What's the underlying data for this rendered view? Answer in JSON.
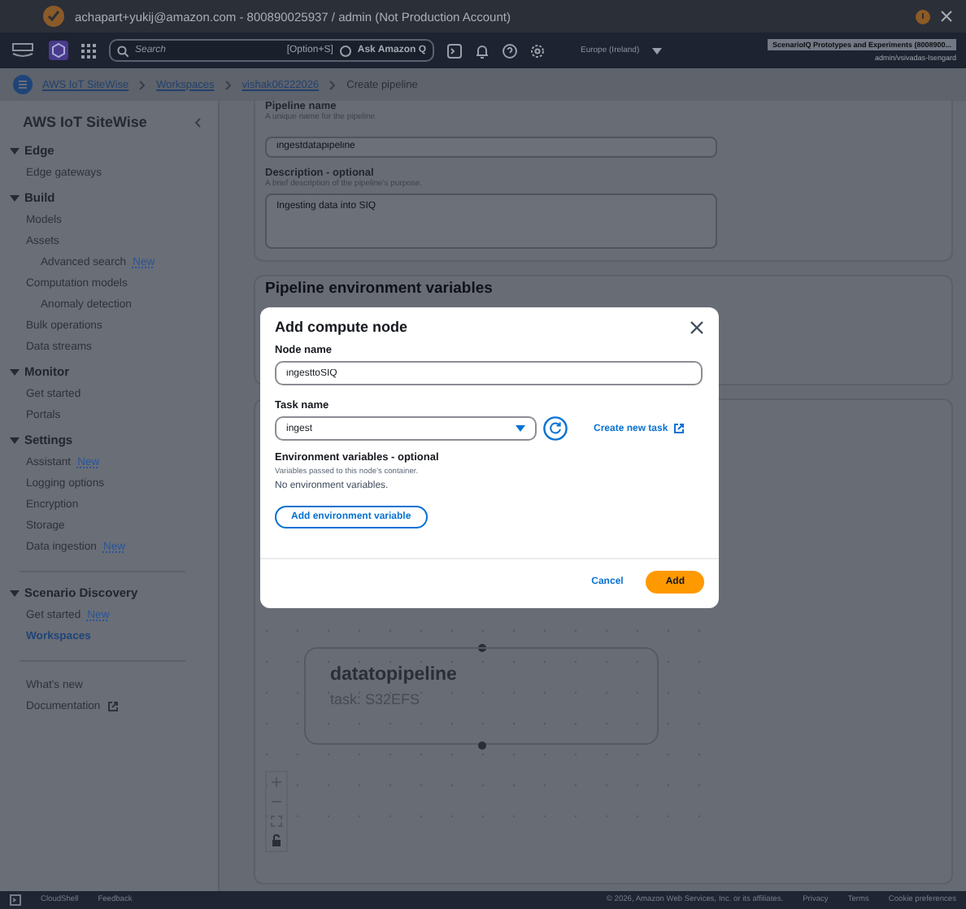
{
  "title_bar": {
    "text": "achapart+yukij@amazon.com - 800890025937 / admin (Not Production Account)"
  },
  "nav_bar": {
    "search": {
      "placeholder": "Search"
    },
    "shortcut": "[Option+S]",
    "ask": "Ask Amazon Q",
    "region": "Europe (Ireland)",
    "account": "ScenarioIQ Prototypes and Experiments (8008900...",
    "user": "admin/vsivadas-Isengard"
  },
  "breadcrumbs": [
    {
      "label": "AWS IoT SiteWise",
      "kind": "link"
    },
    {
      "label": "Workspaces",
      "kind": "link"
    },
    {
      "label": "vishak06222026",
      "kind": "link"
    },
    {
      "label": "Create pipeline",
      "kind": "current"
    }
  ],
  "sidebar": {
    "title": "AWS IoT SiteWise",
    "sections": [
      {
        "label": "Edge",
        "expanded": true,
        "items": [
          {
            "label": "Edge gateways",
            "selected": false
          }
        ]
      },
      {
        "label": "Build",
        "expanded": true,
        "items": [
          {
            "label": "Models",
            "selected": false
          },
          {
            "label": "Assets",
            "selected": false,
            "children": [
              {
                "label": "Advanced search",
                "badge": "New",
                "selected": false
              }
            ]
          },
          {
            "label": "Computation models",
            "selected": false,
            "children": [
              {
                "label": "Anomaly detection",
                "selected": false
              }
            ]
          },
          {
            "label": "Bulk operations",
            "selected": false
          },
          {
            "label": "Data streams",
            "selected": false
          }
        ]
      },
      {
        "label": "Monitor",
        "expanded": true,
        "items": [
          {
            "label": "Get started",
            "selected": false
          },
          {
            "label": "Portals",
            "selected": false
          }
        ]
      },
      {
        "label": "Settings",
        "expanded": true,
        "items": [
          {
            "label": "Assistant",
            "badge": "New",
            "selected": false
          },
          {
            "label": "Logging options",
            "selected": false
          },
          {
            "label": "Encryption",
            "selected": false
          },
          {
            "label": "Storage",
            "selected": false
          },
          {
            "label": "Data ingestion",
            "badge": "New",
            "selected": false
          }
        ]
      },
      {
        "label": "Scenario Discovery",
        "expanded": true,
        "items": [
          {
            "label": "Get started",
            "badge": "New",
            "selected": false
          },
          {
            "label": "Workspaces",
            "selected": true
          }
        ]
      }
    ],
    "links": [
      {
        "label": "What's new",
        "external": false
      },
      {
        "label": "Documentation",
        "external": true
      }
    ]
  },
  "pipeline_form": {
    "fields": [
      {
        "label": "Pipeline name",
        "hint": "A unique name for the pipeline.",
        "value": "ingestdatapipeline",
        "kind": "input"
      },
      {
        "label": "Description - optional",
        "hint": "A brief description of the pipeline's purpose.",
        "value": "Ingesting data into SIQ",
        "kind": "textarea"
      }
    ]
  },
  "env_card": {
    "title": "Pipeline environment variables"
  },
  "canvas": {
    "node": {
      "title": "datatopipeline",
      "task": "task: S32EFS"
    }
  },
  "modal": {
    "title": "Add compute node",
    "fields": [
      {
        "label": "Node name",
        "value": "ingesttoSIQ",
        "kind": "input"
      },
      {
        "label": "Task name",
        "value": "ingest",
        "kind": "select"
      }
    ],
    "create_task_link": "Create new task",
    "env": {
      "label": "Environment variables - optional",
      "hint": "Variables passed to this node's container.",
      "empty_text": "No environment variables.",
      "add_button": "Add environment variable"
    },
    "buttons": [
      {
        "label": "Cancel",
        "kind": "link"
      },
      {
        "label": "Add",
        "kind": "primary"
      }
    ]
  },
  "footer": {
    "left": [
      "CloudShell",
      "Feedback"
    ],
    "copyright": "© 2026, Amazon Web Services, Inc. or its affiliates.",
    "links": [
      "Privacy",
      "Terms",
      "Cookie preferences"
    ]
  }
}
